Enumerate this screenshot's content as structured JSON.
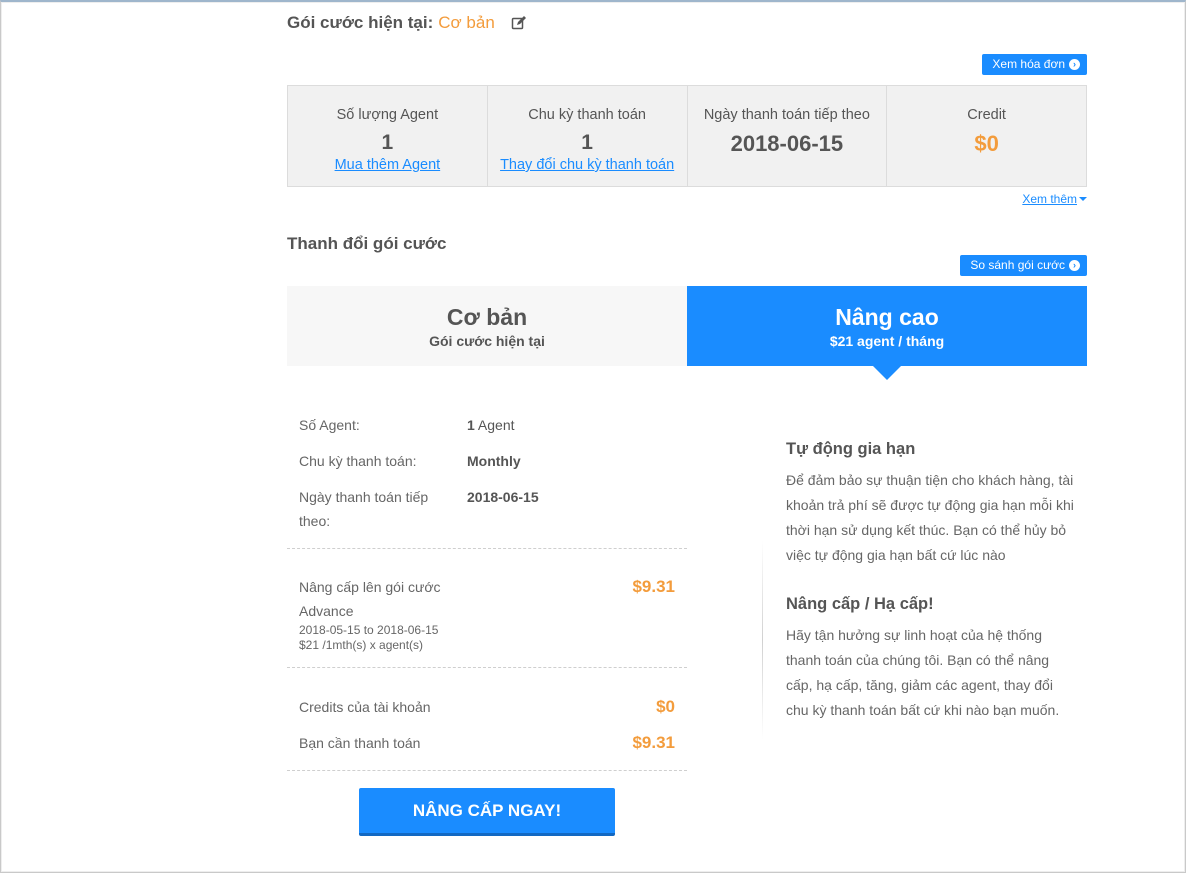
{
  "current_plan": {
    "label": "Gói cước hiện tại:",
    "name": "Cơ bản",
    "edit_icon": "edit-icon"
  },
  "buttons": {
    "view_invoice": "Xem hóa đơn",
    "compare_plans": "So sánh gói cước",
    "upgrade_now": "NÂNG CẤP NGAY!"
  },
  "stats": [
    {
      "label": "Số lượng Agent",
      "value": "1",
      "link": "Mua thêm Agent"
    },
    {
      "label": "Chu kỳ thanh toán",
      "value": "1",
      "link": "Thay đổi chu kỳ thanh toán"
    },
    {
      "label": "Ngày thanh toán tiếp theo",
      "value": "2018-06-15"
    },
    {
      "label": "Credit",
      "value": "$0"
    }
  ],
  "see_more": "Xem thêm",
  "change_plan_title": "Thanh đổi gói cước",
  "tabs": [
    {
      "name": "Cơ bản",
      "sub": "Gói cước hiện tại"
    },
    {
      "name": "Nâng cao",
      "sub": "$21 agent / tháng"
    }
  ],
  "details": {
    "agents_label": "Số Agent:",
    "agents_num": "1",
    "agents_unit": " Agent",
    "cycle_label": "Chu kỳ thanh toán:",
    "cycle_value": "Monthly",
    "next_date_label": "Ngày thanh toán tiếp theo:",
    "next_date_value": "2018-06-15"
  },
  "charges": {
    "upgrade_label": "Nâng cấp lên gói cước Advance",
    "upgrade_detail": "2018-05-15 to 2018-06-15 $21 /1mth(s) x agent(s)",
    "upgrade_amount": "$9.31",
    "credits_label": "Credits của tài khoản",
    "credits_amount": "$0",
    "due_label": "Bạn cần thanh toán",
    "due_amount": "$9.31"
  },
  "info": {
    "auto_renew_title": "Tự động gia hạn",
    "auto_renew_text": "Để đảm bảo sự thuận tiện cho khách hàng, tài khoản trả phí sẽ được tự động gia hạn mỗi khi thời hạn sử dụng kết thúc. Bạn có thể hủy bỏ việc tự động gia hạn bất cứ lúc nào",
    "upgrade_title": "Nâng cấp / Hạ cấp!",
    "upgrade_text": "Hãy tận hưởng sự linh hoạt của hệ thống thanh toán của chúng tôi. Bạn có thể nâng cấp, hạ cấp, tăng, giảm các agent, thay đổi chu kỳ thanh toán bất cứ khi nào bạn muốn."
  },
  "colors": {
    "accent": "#1a8cff",
    "highlight": "#f39c3c"
  }
}
